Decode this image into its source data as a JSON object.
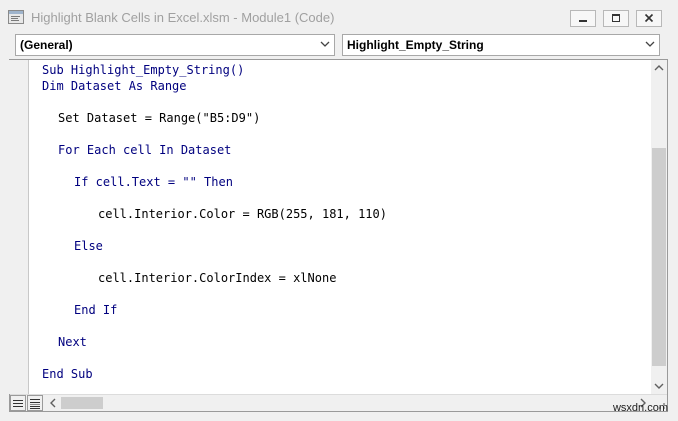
{
  "window": {
    "title": "Highlight Blank Cells in Excel.xlsm - Module1 (Code)",
    "app_icon": "vba-code-window-icon",
    "controls": [
      "minimize-icon",
      "restore-icon",
      "close-icon"
    ]
  },
  "object_box": {
    "value": "(General)"
  },
  "procedure_box": {
    "value": "Highlight_Empty_String"
  },
  "code": {
    "lines": [
      "Sub Highlight_Empty_String()",
      "Dim Dataset As Range",
      "Set Dataset = Range(\"B5:D9\")",
      "For Each cell In Dataset",
      "If cell.Text = \"\" Then",
      "cell.Interior.Color = RGB(255, 181, 110)",
      "Else",
      "cell.Interior.ColorIndex = xlNone",
      "End If",
      "Next",
      "End Sub"
    ],
    "keyword_color": "#00007f",
    "text_color": "#000000"
  },
  "status": {
    "view_buttons": [
      "procedure-view-icon",
      "full-module-view-icon"
    ],
    "watermark": "wsxdn.com"
  }
}
